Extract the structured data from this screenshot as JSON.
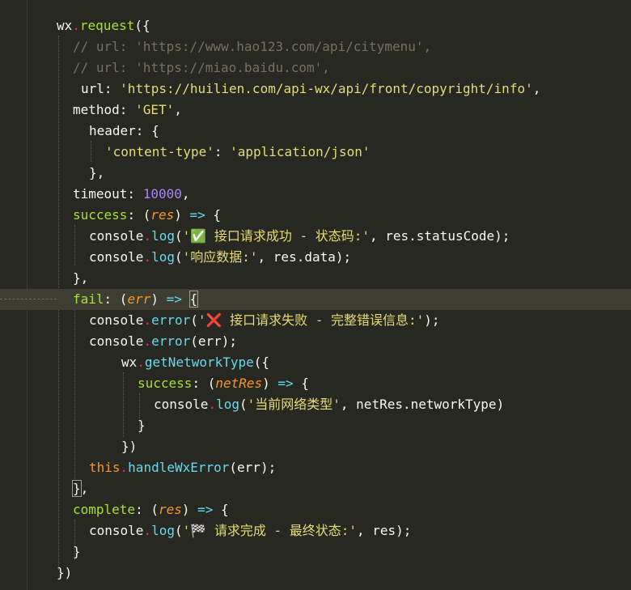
{
  "editor": {
    "lines": [
      {
        "indent": 70,
        "parts": [
          [
            "tok-key",
            "wx"
          ],
          [
            "tok-dot",
            "."
          ],
          [
            "tok-func",
            "request"
          ],
          [
            "tok-key",
            "({"
          ]
        ]
      },
      {
        "indent": 90,
        "parts": [
          [
            "tok-comment",
            "// url: 'https://www.hao123.com/api/citymenu',"
          ]
        ]
      },
      {
        "indent": 90,
        "parts": [
          [
            "tok-comment",
            "// url: 'https://miao.baidu.com',"
          ]
        ]
      },
      {
        "indent": 100,
        "parts": [
          [
            "tok-key",
            "url: "
          ],
          [
            "tok-string",
            "'https://huilien.com/api-wx/api/front/copyright/info'"
          ],
          [
            "tok-key",
            ","
          ]
        ]
      },
      {
        "indent": 90,
        "parts": [
          [
            "tok-key",
            "method: "
          ],
          [
            "tok-string",
            "'GET'"
          ],
          [
            "tok-key",
            ","
          ]
        ]
      },
      {
        "indent": 110,
        "parts": [
          [
            "tok-key",
            "header: {"
          ]
        ]
      },
      {
        "indent": 130,
        "parts": [
          [
            "tok-string",
            "'content-type'"
          ],
          [
            "tok-key",
            ": "
          ],
          [
            "tok-string",
            "'application/json'"
          ]
        ]
      },
      {
        "indent": 110,
        "parts": [
          [
            "tok-key",
            "},"
          ]
        ]
      },
      {
        "indent": 90,
        "parts": [
          [
            "tok-key",
            "timeout: "
          ],
          [
            "tok-number",
            "10000"
          ],
          [
            "tok-key",
            ","
          ]
        ]
      },
      {
        "indent": 90,
        "parts": [
          [
            "tok-func",
            "success"
          ],
          [
            "tok-key",
            ": ("
          ],
          [
            "tok-param",
            "res"
          ],
          [
            "tok-key",
            ") "
          ],
          [
            "tok-arrow",
            "=>"
          ],
          [
            "tok-key",
            " {"
          ]
        ]
      },
      {
        "indent": 110,
        "parts": [
          [
            "tok-key",
            "console"
          ],
          [
            "tok-dot",
            "."
          ],
          [
            "tok-method",
            "log"
          ],
          [
            "tok-key",
            "("
          ],
          [
            "tok-string",
            "'✅ 接口请求成功 - 状态码:'"
          ],
          [
            "tok-key",
            ", res.statusCode);"
          ]
        ]
      },
      {
        "indent": 110,
        "parts": [
          [
            "tok-key",
            "console"
          ],
          [
            "tok-dot",
            "."
          ],
          [
            "tok-method",
            "log"
          ],
          [
            "tok-key",
            "("
          ],
          [
            "tok-string",
            "'响应数据:'"
          ],
          [
            "tok-key",
            ", res.data);"
          ]
        ]
      },
      {
        "indent": 90,
        "parts": [
          [
            "tok-key",
            "},"
          ]
        ]
      },
      {
        "indent": 90,
        "active": true,
        "parts": [
          [
            "tok-func",
            "fail"
          ],
          [
            "tok-key",
            ": ("
          ],
          [
            "tok-param",
            "err"
          ],
          [
            "tok-key",
            ") "
          ],
          [
            "tok-arrow",
            "=>"
          ],
          [
            "tok-key",
            " "
          ],
          [
            "bracket",
            "{"
          ]
        ]
      },
      {
        "indent": 110,
        "parts": [
          [
            "tok-key",
            "console"
          ],
          [
            "tok-dot",
            "."
          ],
          [
            "tok-method",
            "error"
          ],
          [
            "tok-key",
            "("
          ],
          [
            "tok-string",
            "'❌ 接口请求失败 - 完整错误信息:'"
          ],
          [
            "tok-key",
            ");"
          ]
        ]
      },
      {
        "indent": 110,
        "parts": [
          [
            "tok-key",
            "console"
          ],
          [
            "tok-dot",
            "."
          ],
          [
            "tok-method",
            "error"
          ],
          [
            "tok-key",
            "(err);"
          ]
        ]
      },
      {
        "indent": 150,
        "parts": [
          [
            "tok-key",
            "wx"
          ],
          [
            "tok-dot",
            "."
          ],
          [
            "tok-method",
            "getNetworkType"
          ],
          [
            "tok-key",
            "({"
          ]
        ]
      },
      {
        "indent": 170,
        "parts": [
          [
            "tok-func",
            "success"
          ],
          [
            "tok-key",
            ": ("
          ],
          [
            "tok-param",
            "netRes"
          ],
          [
            "tok-key",
            ") "
          ],
          [
            "tok-arrow",
            "=>"
          ],
          [
            "tok-key",
            " {"
          ]
        ]
      },
      {
        "indent": 190,
        "parts": [
          [
            "tok-key",
            "console"
          ],
          [
            "tok-dot",
            "."
          ],
          [
            "tok-method",
            "log"
          ],
          [
            "tok-key",
            "("
          ],
          [
            "tok-string",
            "'当前网络类型'"
          ],
          [
            "tok-key",
            ", netRes.networkType)"
          ]
        ]
      },
      {
        "indent": 170,
        "parts": [
          [
            "tok-key",
            "}"
          ]
        ]
      },
      {
        "indent": 150,
        "parts": [
          [
            "tok-key",
            "})"
          ]
        ]
      },
      {
        "indent": 110,
        "parts": [
          [
            "tok-this",
            "this"
          ],
          [
            "tok-dot",
            "."
          ],
          [
            "tok-method",
            "handleWxError"
          ],
          [
            "tok-key",
            "(err);"
          ]
        ]
      },
      {
        "indent": 90,
        "parts": [
          [
            "bracket",
            "}"
          ],
          [
            "tok-key",
            ","
          ]
        ]
      },
      {
        "indent": 90,
        "parts": [
          [
            "tok-func",
            "complete"
          ],
          [
            "tok-key",
            ": ("
          ],
          [
            "tok-param",
            "res"
          ],
          [
            "tok-key",
            ") "
          ],
          [
            "tok-arrow",
            "=>"
          ],
          [
            "tok-key",
            " {"
          ]
        ]
      },
      {
        "indent": 110,
        "parts": [
          [
            "tok-key",
            "console"
          ],
          [
            "tok-dot",
            "."
          ],
          [
            "tok-method",
            "log"
          ],
          [
            "tok-key",
            "("
          ],
          [
            "tok-string",
            "'🏁 请求完成 - 最终状态:'"
          ],
          [
            "tok-key",
            ", res);"
          ]
        ]
      },
      {
        "indent": 90,
        "parts": [
          [
            "tok-key",
            "}"
          ]
        ]
      },
      {
        "indent": 70,
        "parts": [
          [
            "tok-key",
            "})"
          ]
        ]
      }
    ]
  },
  "colors": {
    "background": "#272822",
    "active_line": "#3e3d32",
    "string": "#e6db74",
    "comment": "#75715e",
    "function": "#a6e22e",
    "param": "#fd971f",
    "number": "#ae81ff",
    "keyword": "#66d9ef"
  }
}
